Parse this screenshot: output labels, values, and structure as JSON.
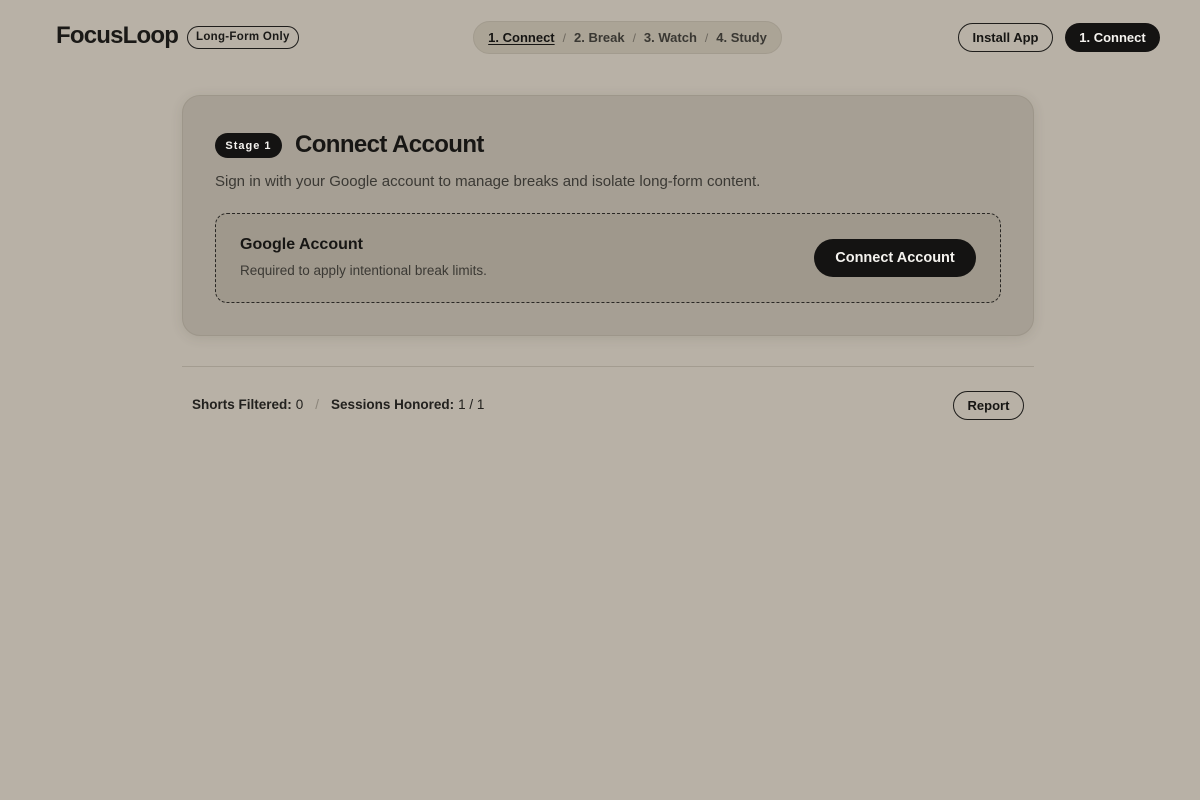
{
  "header": {
    "brand": "FocusLoop",
    "brand_badge": "Long-Form Only",
    "steps": [
      {
        "label": "1. Connect",
        "active": true
      },
      {
        "label": "2. Break",
        "active": false
      },
      {
        "label": "3. Watch",
        "active": false
      },
      {
        "label": "4. Study",
        "active": false
      }
    ],
    "step_separator": "/",
    "install_label": "Install App",
    "current_step_label": "1. Connect"
  },
  "card": {
    "stage_badge": "Stage 1",
    "title": "Connect Account",
    "description": "Sign in with your Google account to manage breaks and isolate long-form content.",
    "account": {
      "title": "Google Account",
      "subtitle": "Required to apply intentional break limits.",
      "button_label": "Connect Account"
    }
  },
  "footer": {
    "shorts_label": "Shorts Filtered:",
    "shorts_value": "0",
    "separator": "/",
    "sessions_label": "Sessions Honored:",
    "sessions_value": "1 / 1",
    "report_label": "Report"
  },
  "colors": {
    "background": "#b8b1a6",
    "card": "#a69f94",
    "dark": "#141312"
  }
}
